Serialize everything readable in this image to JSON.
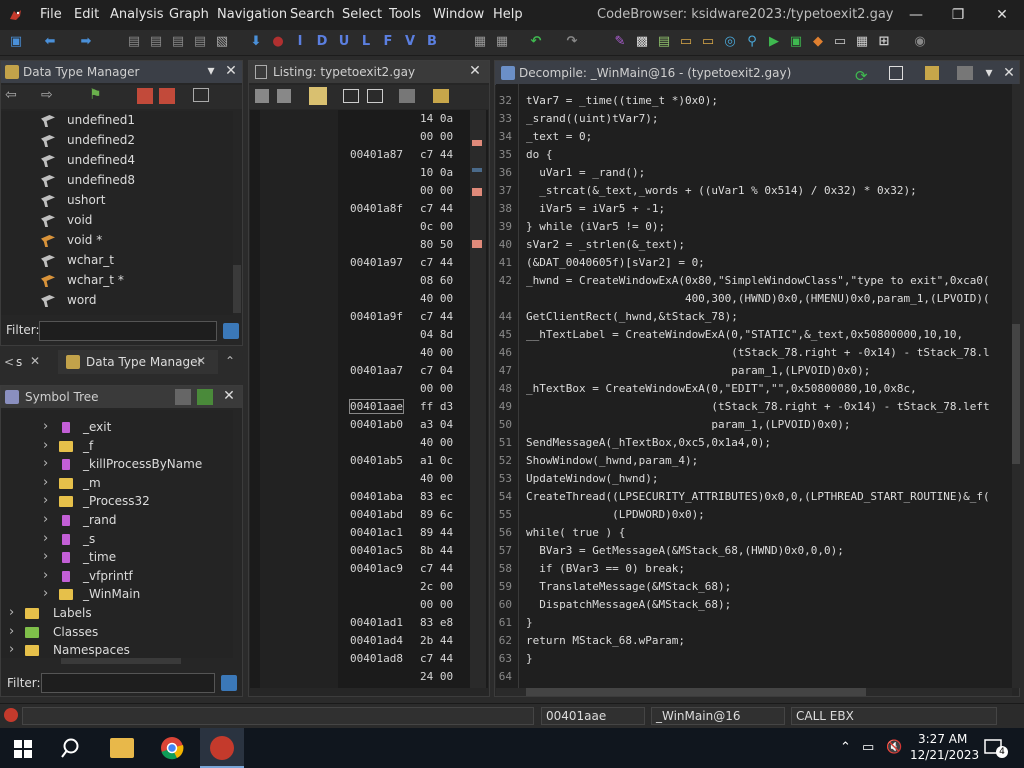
{
  "menus": [
    "File",
    "Edit",
    "Analysis",
    "Graph",
    "Navigation",
    "Search",
    "Select",
    "Tools",
    "Window",
    "Help"
  ],
  "app_title": "CodeBrowser: ksidware2023:/typetoexit2.gay",
  "window_controls": {
    "minimize": "—",
    "restore": "❐",
    "close": "✕"
  },
  "toolbar_letters": [
    "I",
    "D",
    "U",
    "L",
    "F",
    "V",
    "B"
  ],
  "data_type_manager": {
    "title": "Data Type Manager",
    "items": [
      {
        "label": "undefined1",
        "icon": "hammer-icon"
      },
      {
        "label": "undefined2",
        "icon": "hammer-icon"
      },
      {
        "label": "undefined4",
        "icon": "hammer-icon"
      },
      {
        "label": "undefined8",
        "icon": "hammer-icon"
      },
      {
        "label": "ushort",
        "icon": "hammer-icon"
      },
      {
        "label": "void",
        "icon": "hammer-icon"
      },
      {
        "label": "void *",
        "icon": "pointer-icon"
      },
      {
        "label": "wchar_t",
        "icon": "hammer-icon"
      },
      {
        "label": "wchar_t *",
        "icon": "pointer-icon"
      },
      {
        "label": "word",
        "icon": "hammer-icon"
      }
    ],
    "filter_label": "Filter:",
    "filter_value": ""
  },
  "tabs_row": {
    "left_tab": "s",
    "main_tab": "Data Type Manager"
  },
  "symbol_tree": {
    "title": "Symbol Tree",
    "items": [
      {
        "label": "_exit",
        "type": "function",
        "indent": 1
      },
      {
        "label": "_f",
        "type": "folder",
        "indent": 1
      },
      {
        "label": "_killProcessByName",
        "type": "function",
        "indent": 1
      },
      {
        "label": "_m",
        "type": "folder",
        "indent": 1
      },
      {
        "label": "_Process32",
        "type": "folder",
        "indent": 1
      },
      {
        "label": "_rand",
        "type": "function",
        "indent": 1
      },
      {
        "label": "_s",
        "type": "function",
        "indent": 1
      },
      {
        "label": "_time",
        "type": "function",
        "indent": 1
      },
      {
        "label": "_vfprintf",
        "type": "function",
        "indent": 1
      },
      {
        "label": "_WinMain",
        "type": "folder",
        "indent": 1
      },
      {
        "label": "Labels",
        "type": "folder",
        "indent": 0
      },
      {
        "label": "Classes",
        "type": "folder",
        "indent": 0
      },
      {
        "label": "Namespaces",
        "type": "folder",
        "indent": 0
      }
    ],
    "filter_label": "Filter:",
    "filter_value": ""
  },
  "listing": {
    "title": "Listing:  typetoexit2.gay",
    "rows": [
      {
        "addr": "",
        "bytes": "14 0a"
      },
      {
        "addr": "",
        "bytes": "00 00"
      },
      {
        "addr": "00401a87",
        "bytes": "c7 44"
      },
      {
        "addr": "",
        "bytes": "10 0a"
      },
      {
        "addr": "",
        "bytes": "00 00"
      },
      {
        "addr": "00401a8f",
        "bytes": "c7 44"
      },
      {
        "addr": "",
        "bytes": "0c 00"
      },
      {
        "addr": "",
        "bytes": "80 50"
      },
      {
        "addr": "00401a97",
        "bytes": "c7 44"
      },
      {
        "addr": "",
        "bytes": "08 60"
      },
      {
        "addr": "",
        "bytes": "40 00"
      },
      {
        "addr": "00401a9f",
        "bytes": "c7 44"
      },
      {
        "addr": "",
        "bytes": "04 8d"
      },
      {
        "addr": "",
        "bytes": "40 00"
      },
      {
        "addr": "00401aa7",
        "bytes": "c7 04"
      },
      {
        "addr": "",
        "bytes": "00 00"
      },
      {
        "addr": "00401aae",
        "bytes": "ff d3"
      },
      {
        "addr": "00401ab0",
        "bytes": "a3 04"
      },
      {
        "addr": "",
        "bytes": "40 00"
      },
      {
        "addr": "00401ab5",
        "bytes": "a1 0c"
      },
      {
        "addr": "",
        "bytes": "40 00"
      },
      {
        "addr": "00401aba",
        "bytes": "83 ec"
      },
      {
        "addr": "00401abd",
        "bytes": "89 6c"
      },
      {
        "addr": "00401ac1",
        "bytes": "89 44"
      },
      {
        "addr": "00401ac5",
        "bytes": "8b 44"
      },
      {
        "addr": "00401ac9",
        "bytes": "c7 44"
      },
      {
        "addr": "",
        "bytes": "2c 00"
      },
      {
        "addr": "",
        "bytes": "00 00"
      },
      {
        "addr": "00401ad1",
        "bytes": "83 e8"
      },
      {
        "addr": "00401ad4",
        "bytes": "2b 44"
      },
      {
        "addr": "00401ad8",
        "bytes": "c7 44"
      },
      {
        "addr": "",
        "bytes": "24 00"
      }
    ]
  },
  "decompile": {
    "title": "Decompile: _WinMain@16 -  (typetoexit2.gay)",
    "lines": [
      {
        "n": "32",
        "code": "tVar7 = _time((time_t *)0x0);"
      },
      {
        "n": "33",
        "code": "_srand((uint)tVar7);"
      },
      {
        "n": "34",
        "code": "_text = 0;"
      },
      {
        "n": "35",
        "code": "do {"
      },
      {
        "n": "36",
        "code": "  uVar1 = _rand();"
      },
      {
        "n": "37",
        "code": "  _strcat(&_text,_words + ((uVar1 % 0x514) / 0x32) * 0x32);"
      },
      {
        "n": "38",
        "code": "  iVar5 = iVar5 + -1;"
      },
      {
        "n": "39",
        "code": "} while (iVar5 != 0);"
      },
      {
        "n": "40",
        "code": "sVar2 = _strlen(&_text);"
      },
      {
        "n": "41",
        "code": "(&DAT_0040605f)[sVar2] = 0;"
      },
      {
        "n": "42",
        "code": "_hwnd = CreateWindowExA(0x80,\"SimpleWindowClass\",\"type to exit\",0xca0("
      },
      {
        "n": "",
        "code": "                        400,300,(HWND)0x0,(HMENU)0x0,param_1,(LPVOID)("
      },
      {
        "n": "44",
        "code": "GetClientRect(_hwnd,&tStack_78);"
      },
      {
        "n": "45",
        "code": "__hTextLabel = CreateWindowExA(0,\"STATIC\",&_text,0x50800000,10,10,"
      },
      {
        "n": "46",
        "code": "                               (tStack_78.right + -0x14) - tStack_78.l"
      },
      {
        "n": "47",
        "code": "                               param_1,(LPVOID)0x0);"
      },
      {
        "n": "48",
        "code": "_hTextBox = CreateWindowExA(0,\"EDIT\",\"\",0x50800080,10,0x8c,"
      },
      {
        "n": "49",
        "code": "                            (tStack_78.right + -0x14) - tStack_78.left"
      },
      {
        "n": "50",
        "code": "                            param_1,(LPVOID)0x0);"
      },
      {
        "n": "51",
        "code": "SendMessageA(_hTextBox,0xc5,0x1a4,0);"
      },
      {
        "n": "52",
        "code": "ShowWindow(_hwnd,param_4);"
      },
      {
        "n": "53",
        "code": "UpdateWindow(_hwnd);"
      },
      {
        "n": "54",
        "code": "CreateThread((LPSECURITY_ATTRIBUTES)0x0,0,(LPTHREAD_START_ROUTINE)&_f("
      },
      {
        "n": "55",
        "code": "             (LPDWORD)0x0);"
      },
      {
        "n": "56",
        "code": "while( true ) {"
      },
      {
        "n": "57",
        "code": "  BVar3 = GetMessageA(&MStack_68,(HWND)0x0,0,0);"
      },
      {
        "n": "58",
        "code": "  if (BVar3 == 0) break;"
      },
      {
        "n": "59",
        "code": "  TranslateMessage(&MStack_68);"
      },
      {
        "n": "60",
        "code": "  DispatchMessageA(&MStack_68);"
      },
      {
        "n": "61",
        "code": "}"
      },
      {
        "n": "62",
        "code": "return MStack_68.wParam;"
      },
      {
        "n": "63",
        "code": "}"
      },
      {
        "n": "64",
        "code": ""
      }
    ]
  },
  "status": {
    "address": "00401aae",
    "function": "_WinMain@16",
    "instruction": "CALL EBX"
  },
  "taskbar": {
    "time": "3:27 AM",
    "date": "12/21/2023",
    "notifications": "4"
  },
  "colors": {
    "accent": "#2f5a8c",
    "link_blue": "#7ea2c8",
    "ghidra_red": "#d13b2e"
  }
}
